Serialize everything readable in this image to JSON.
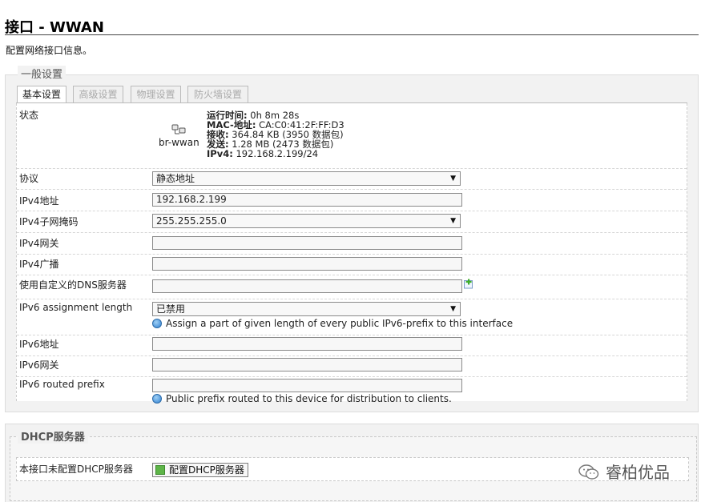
{
  "page": {
    "title": "接口 - WWAN",
    "description": "配置网络接口信息。"
  },
  "general": {
    "legend": "一般设置",
    "tabs": [
      {
        "label": "基本设置",
        "active": true
      },
      {
        "label": "高级设置",
        "active": false
      },
      {
        "label": "物理设置",
        "active": false
      },
      {
        "label": "防火墙设置",
        "active": false
      }
    ],
    "status": {
      "label": "状态",
      "interface_name": "br-wwan",
      "icon": "network-bridge-icon",
      "uptime_key": "运行时间:",
      "uptime_value": "0h 8m 28s",
      "mac_key": "MAC-地址:",
      "mac_value": "CA:C0:41:2F:FF:D3",
      "rx_key": "接收:",
      "rx_value": "364.84 KB (3950 数据包)",
      "tx_key": "发送:",
      "tx_value": "1.28 MB (2473 数据包)",
      "ipv4_key": "IPv4:",
      "ipv4_value": "192.168.2.199/24"
    },
    "fields": {
      "protocol": {
        "label": "协议",
        "value": "静态地址"
      },
      "ipv4_address": {
        "label": "IPv4地址",
        "value": "192.168.2.199"
      },
      "ipv4_netmask": {
        "label": "IPv4子网掩码",
        "value": "255.255.255.0"
      },
      "ipv4_gateway": {
        "label": "IPv4网关",
        "value": ""
      },
      "ipv4_broadcast": {
        "label": "IPv4广播",
        "value": ""
      },
      "custom_dns": {
        "label": "使用自定义的DNS服务器",
        "value": ""
      },
      "ipv6_assign": {
        "label": "IPv6 assignment length",
        "value": "已禁用",
        "help": "Assign a part of given length of every public IPv6-prefix to this interface"
      },
      "ipv6_address": {
        "label": "IPv6地址",
        "value": ""
      },
      "ipv6_gateway": {
        "label": "IPv6网关",
        "value": ""
      },
      "ipv6_routed_prefix": {
        "label": "IPv6 routed prefix",
        "value": "",
        "help": "Public prefix routed to this device for distribution to clients."
      }
    }
  },
  "dhcp": {
    "legend": "DHCP服务器",
    "row_label": "本接口未配置DHCP服务器",
    "button_label": "配置DHCP服务器"
  },
  "watermark": {
    "text": "睿柏优品",
    "icon": "wechat-icon"
  },
  "colors": {
    "section_bg": "#f2f2f2",
    "info_icon": "#2f7fd0",
    "button_icon": "#5eb548"
  }
}
